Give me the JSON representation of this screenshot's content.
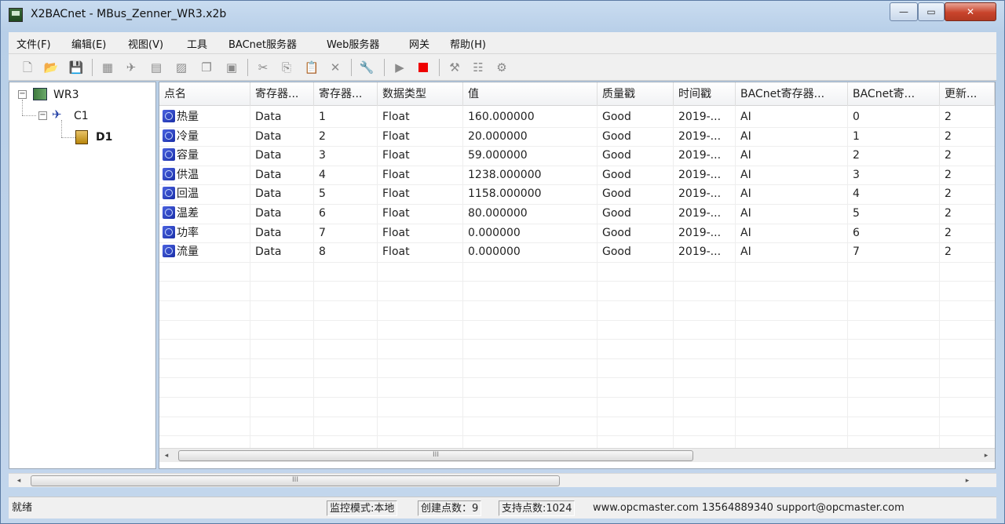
{
  "window": {
    "title": "X2BACnet - MBus_Zenner_WR3.x2b",
    "controls": {
      "minimize": "—",
      "maximize": "▭",
      "close": "✕"
    }
  },
  "menu": [
    "文件(F)",
    "编辑(E)",
    "视图(V)",
    "工具",
    "BACnet服务器",
    "Web服务器",
    "网关",
    "帮助(H)"
  ],
  "toolbar": {
    "icons": [
      "new-icon",
      "open-icon",
      "save-icon",
      "add-server-icon",
      "add-channel-icon",
      "add-device-icon",
      "add-point-icon",
      "copy-device-icon",
      "paste-device-icon",
      "cut-icon",
      "copy-icon",
      "paste-icon",
      "delete-icon",
      "properties-icon",
      "run-icon",
      "stop-icon",
      "tools-icon",
      "batch-icon",
      "settings-icon"
    ]
  },
  "tree": {
    "root": "WR3",
    "channel": "C1",
    "device": "D1"
  },
  "table": {
    "columns": [
      "点名",
      "寄存器...",
      "寄存器...",
      "数据类型",
      "值",
      "质量戳",
      "时间戳",
      "BACnet寄存器...",
      "BACnet寄...",
      "更新..."
    ],
    "rows": [
      [
        "热量",
        "Data",
        "1",
        "Float",
        "160.000000",
        "Good",
        "2019-...",
        "AI",
        "0",
        "2"
      ],
      [
        "冷量",
        "Data",
        "2",
        "Float",
        "20.000000",
        "Good",
        "2019-...",
        "AI",
        "1",
        "2"
      ],
      [
        "容量",
        "Data",
        "3",
        "Float",
        "59.000000",
        "Good",
        "2019-...",
        "AI",
        "2",
        "2"
      ],
      [
        "供温",
        "Data",
        "4",
        "Float",
        "1238.000000",
        "Good",
        "2019-...",
        "AI",
        "3",
        "2"
      ],
      [
        "回温",
        "Data",
        "5",
        "Float",
        "1158.000000",
        "Good",
        "2019-...",
        "AI",
        "4",
        "2"
      ],
      [
        "温差",
        "Data",
        "6",
        "Float",
        "80.000000",
        "Good",
        "2019-...",
        "AI",
        "5",
        "2"
      ],
      [
        "功率",
        "Data",
        "7",
        "Float",
        "0.000000",
        "Good",
        "2019-...",
        "AI",
        "6",
        "2"
      ],
      [
        "流量",
        "Data",
        "8",
        "Float",
        "0.000000",
        "Good",
        "2019-...",
        "AI",
        "7",
        "2"
      ]
    ]
  },
  "scrollbars": {
    "thumb_grip": "III",
    "left_arrow": "◂",
    "right_arrow": "▸"
  },
  "status": {
    "ready": "就绪",
    "mode": "监控模式:本地",
    "created": "创建点数：9",
    "supported": "支持点数:1024",
    "contact": "www.opcmaster.com 13564889340 support@opcmaster.com"
  },
  "colors": {
    "accent": "#1a2fa8",
    "stop": "#e00000",
    "close_button": "#c8432b"
  }
}
